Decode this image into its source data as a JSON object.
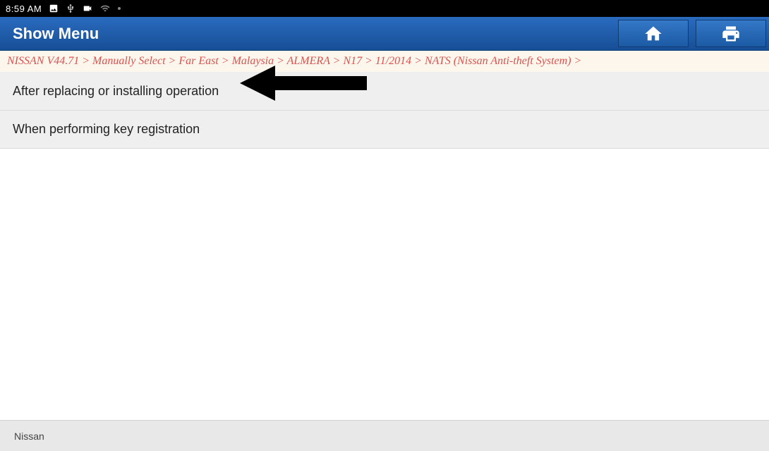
{
  "status": {
    "time": "8:59 AM"
  },
  "titlebar": {
    "title": "Show Menu"
  },
  "breadcrumb": {
    "text": "NISSAN V44.71 > Manually Select > Far East > Malaysia > ALMERA > N17 > 11/2014 > NATS (Nissan Anti-theft System) >"
  },
  "menu": {
    "items": [
      {
        "label": "After replacing or installing operation"
      },
      {
        "label": "When performing key registration"
      }
    ]
  },
  "footer": {
    "brand": "Nissan"
  }
}
